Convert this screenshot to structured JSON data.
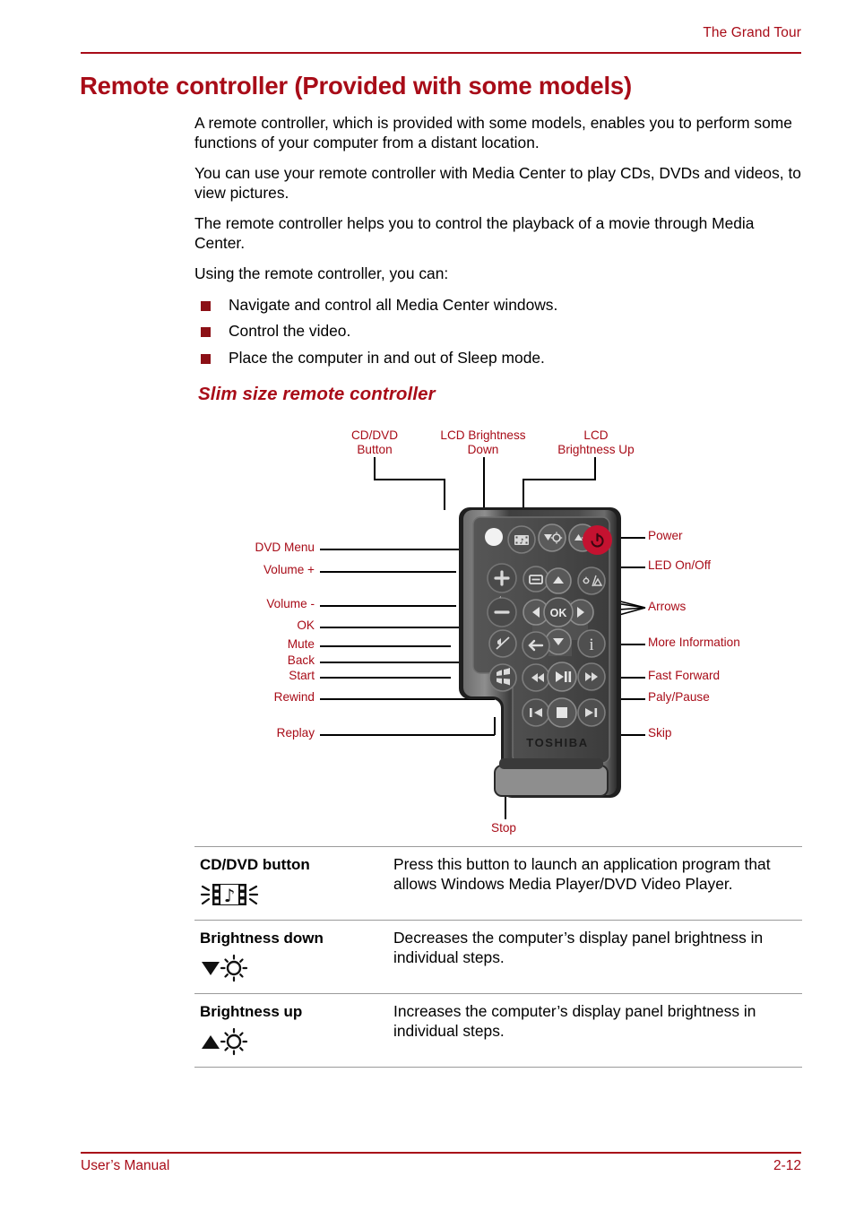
{
  "header": {
    "chapter_title": "The Grand Tour"
  },
  "title": "Remote controller (Provided with some models)",
  "paragraphs": [
    "A remote controller, which is provided with some models, enables you to perform some functions of your computer from a distant location.",
    "You can use your remote controller with Media Center to play CDs, DVDs and videos, to view pictures.",
    "The remote controller helps you to control the playback of a movie through Media Center.",
    "Using the remote controller, you can:"
  ],
  "bullets": [
    "Navigate and control all Media Center windows.",
    "Control the video.",
    "Place the computer in and out of Sleep mode."
  ],
  "subheading": "Slim size remote controller",
  "figure": {
    "top_labels": [
      "CD/DVD\nButton",
      "LCD Brightness\nDown",
      "LCD\nBrightness Up"
    ],
    "left_labels": [
      "DVD Menu",
      "Volume +",
      "Volume -",
      "OK",
      "Mute",
      "Back",
      "Start",
      "Rewind",
      "Replay"
    ],
    "right_labels": [
      "Power",
      "LED On/Off",
      "Arrows",
      "More Information",
      "Fast Forward",
      "Paly/Pause",
      "Skip"
    ],
    "bottom_label": "Stop",
    "brand": "TOSHIBA",
    "ok_button_label": "OK"
  },
  "table": {
    "rows": [
      {
        "label": "CD/DVD button",
        "icon": "cd-dvd-film-note-icon",
        "description": "Press this button to launch an application program that allows Windows Media Player/DVD Video Player."
      },
      {
        "label": "Brightness down",
        "icon": "brightness-down-icon",
        "description": "Decreases the computer’s display panel brightness in individual steps."
      },
      {
        "label": "Brightness up",
        "icon": "brightness-up-icon",
        "description": "Increases the computer’s display panel brightness in individual steps."
      }
    ]
  },
  "footer": {
    "left": "User’s Manual",
    "right": "2-12"
  },
  "colors": {
    "accent_red": "#A80C18",
    "bullet_red": "#8C1016",
    "power_button": "#C41230",
    "remote_body": "#4a4a4a",
    "rule_gray": "#9a9a9a"
  }
}
